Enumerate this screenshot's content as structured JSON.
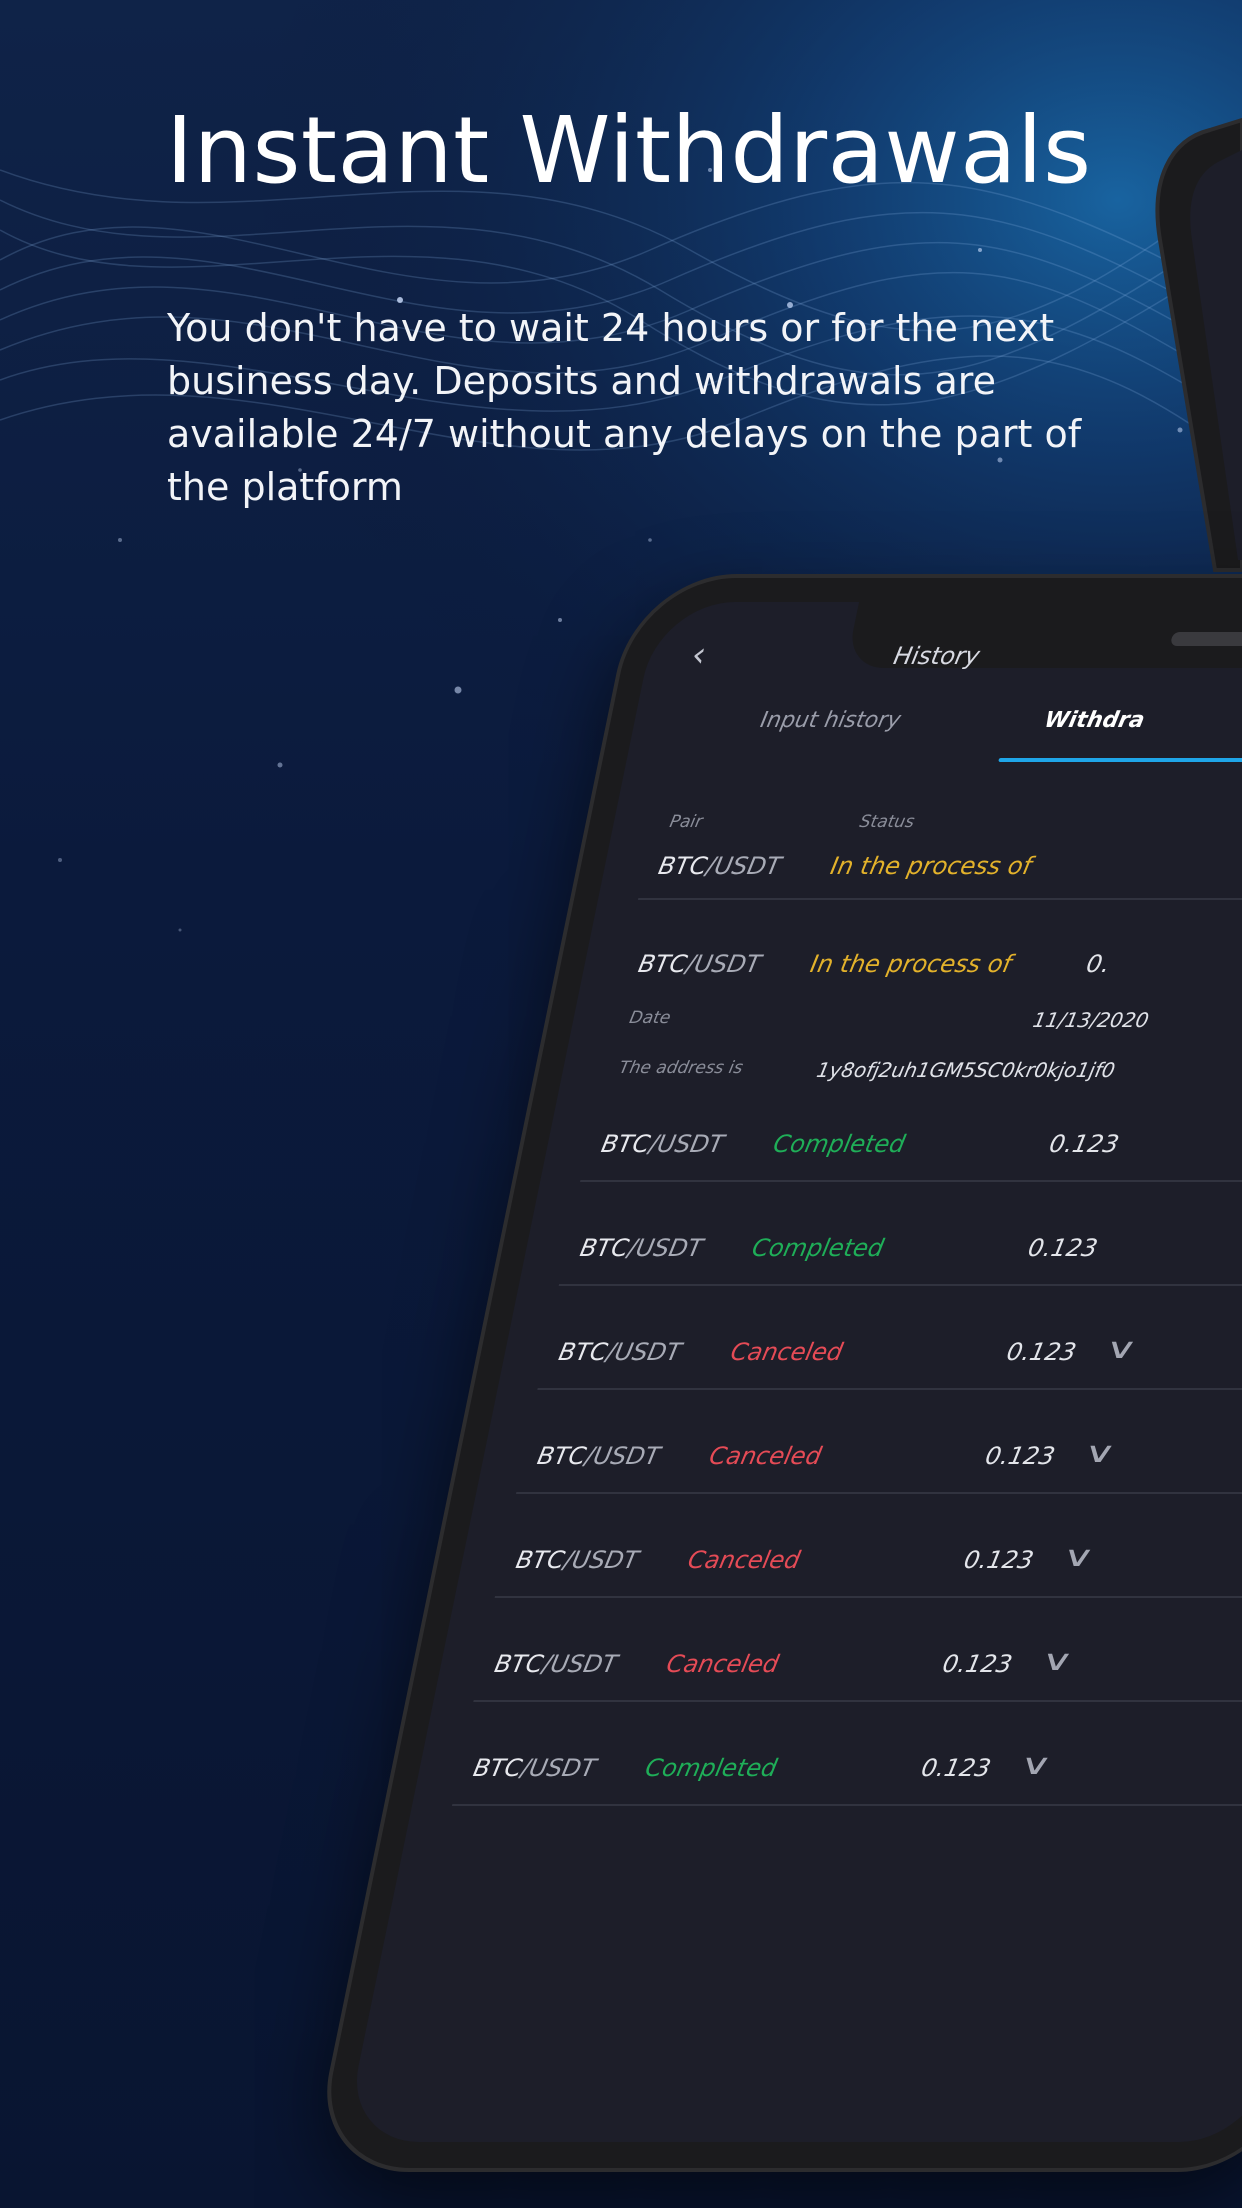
{
  "headline": "Instant Withdrawals",
  "subtext": "You don't have to wait 24 hours or for the next business day. Deposits and withdrawals are available 24/7 without any delays on the part of the platform",
  "colors": {
    "background": "#0b1634",
    "status_pending": "#e3b22b",
    "status_completed": "#1fae58",
    "status_canceled": "#e54b56",
    "tab_underline": "#1fa6e8"
  },
  "app": {
    "back_icon": "chevron-left-icon",
    "title": "History",
    "tabs": [
      {
        "label": "Input history"
      },
      {
        "label": "Withdra"
      }
    ],
    "columns": {
      "pair": "Pair",
      "status": "Status"
    },
    "rows": [
      {
        "base": "BTC",
        "quote": "/USDT",
        "status": "In the process of",
        "status_type": "pending",
        "amount": ""
      },
      {
        "base": "BTC",
        "quote": "/USDT",
        "status": "In the process of",
        "status_type": "pending",
        "amount": "0.",
        "expanded": true
      },
      {
        "base": "BTC",
        "quote": "/USDT",
        "status": "Completed",
        "status_type": "completed",
        "amount": "0.123"
      },
      {
        "base": "BTC",
        "quote": "/USDT",
        "status": "Completed",
        "status_type": "completed",
        "amount": "0.123"
      },
      {
        "base": "BTC",
        "quote": "/USDT",
        "status": "Canceled",
        "status_type": "canceled",
        "amount": "0.123"
      },
      {
        "base": "BTC",
        "quote": "/USDT",
        "status": "Canceled",
        "status_type": "canceled",
        "amount": "0.123"
      },
      {
        "base": "BTC",
        "quote": "/USDT",
        "status": "Canceled",
        "status_type": "canceled",
        "amount": "0.123"
      },
      {
        "base": "BTC",
        "quote": "/USDT",
        "status": "Canceled",
        "status_type": "canceled",
        "amount": "0.123"
      },
      {
        "base": "BTC",
        "quote": "/USDT",
        "status": "Completed",
        "status_type": "completed",
        "amount": "0.123"
      }
    ],
    "detail": {
      "date_label": "Date",
      "date_value": "11/13/2020",
      "address_label": "The address is",
      "address_value": "1y8ofj2uh1GM5SC0kr0kjo1jf0"
    }
  }
}
